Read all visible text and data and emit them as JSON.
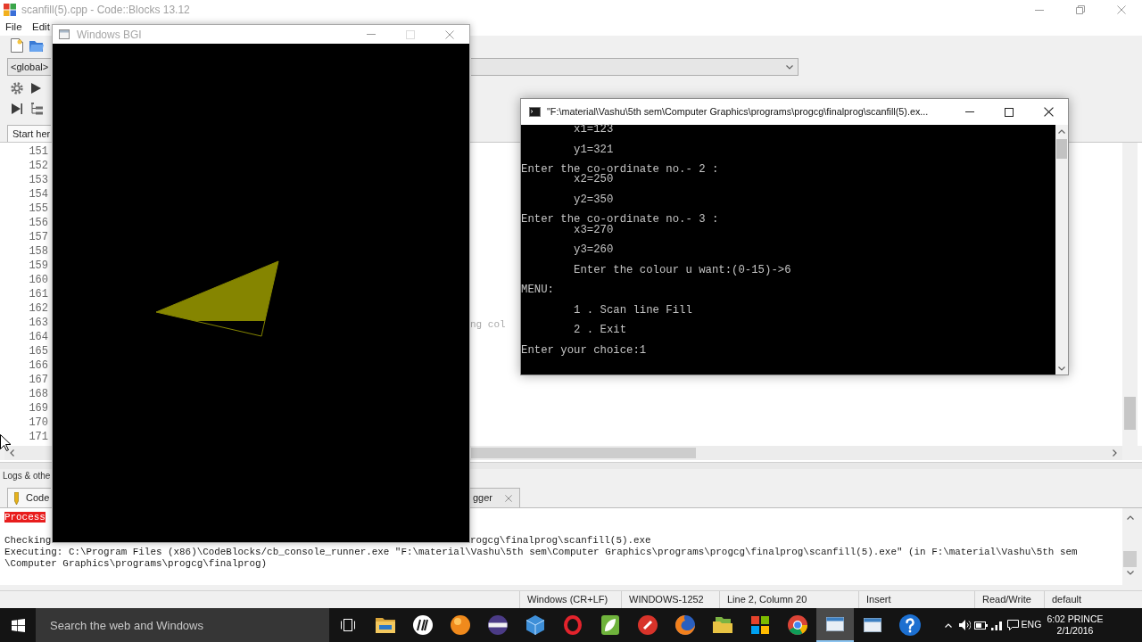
{
  "main_window": {
    "title": "scanfill(5).cpp - Code::Blocks 13.12"
  },
  "menu": [
    "File",
    "Edit"
  ],
  "toolbar": {
    "dropdown_value": "<global>"
  },
  "editor": {
    "tab": "Start her",
    "lines": [
      {
        "number": "151"
      },
      {
        "number": "152"
      },
      {
        "number": "153"
      },
      {
        "number": "154"
      },
      {
        "number": "155"
      },
      {
        "number": "156"
      },
      {
        "number": "157"
      },
      {
        "number": "158"
      },
      {
        "number": "159"
      },
      {
        "number": "160"
      },
      {
        "number": "161"
      },
      {
        "number": "162"
      },
      {
        "number": "163",
        "code": "ng col"
      },
      {
        "number": "164"
      },
      {
        "number": "165"
      },
      {
        "number": "166"
      },
      {
        "number": "167"
      },
      {
        "number": "168"
      },
      {
        "number": "169"
      },
      {
        "number": "170"
      },
      {
        "number": "171"
      }
    ]
  },
  "logs": {
    "title": "Logs & othe",
    "tabs": [
      {
        "label": "Code",
        "kind": "icon"
      },
      {
        "label": "gger",
        "kind": "closable"
      }
    ],
    "lines": [
      {
        "kind": "highlight",
        "parts": [
          "Process"
        ]
      },
      {
        "kind": "plain",
        "parts": [
          "Checking",
          "rogcg\\finalprog\\scanfill(5).exe"
        ]
      },
      {
        "kind": "plain",
        "parts": [
          "Executing: C:\\Program Files (x86)\\CodeBlocks/cb_console_runner.exe \"F:\\material\\Vashu\\5th sem\\Computer Graphics\\programs\\progcg\\finalprog\\scanfill(5).exe\" (in F:\\material\\Vashu\\5th sem"
        ]
      },
      {
        "kind": "plain",
        "parts": [
          "\\Computer Graphics\\programs\\progcg\\finalprog)"
        ]
      }
    ]
  },
  "status_bar": [
    "Windows (CR+LF)",
    "WINDOWS-1252",
    "Line 2, Column 20",
    "Insert",
    "Read/Write",
    "default"
  ],
  "bgi_window": {
    "title": "Windows BGI",
    "maximize_disabled": true
  },
  "console_window": {
    "title": "\"F:\\material\\Vashu\\5th sem\\Computer Graphics\\programs\\progcg\\finalprog\\scanfill(5).ex...",
    "sections": [
      {
        "blocks": [
          {
            "lines": [
              {
                "text": "x1=123",
                "indented": true
              }
            ]
          },
          {
            "lines": [
              {
                "text": "y1=321",
                "indented": true
              }
            ]
          },
          {
            "lines": [
              {
                "text": "Enter the co-ordinate no.- 2 :",
                "indented": false
              },
              {
                "text": "x2=250",
                "indented": true
              }
            ]
          },
          {
            "lines": [
              {
                "text": "y2=350",
                "indented": true
              }
            ]
          },
          {
            "lines": [
              {
                "text": "Enter the co-ordinate no.- 3 :",
                "indented": false
              },
              {
                "text": "x3=270",
                "indented": true
              }
            ]
          },
          {
            "lines": [
              {
                "text": "y3=260",
                "indented": true
              }
            ]
          },
          {
            "lines": [
              {
                "text": "Enter the colour u want:(0-15)->6",
                "indented": true
              }
            ]
          }
        ]
      },
      {
        "blocks": [
          {
            "lines": [
              {
                "text": "MENU:",
                "indented": false
              }
            ]
          },
          {
            "lines": [
              {
                "text": "1 . Scan line Fill",
                "indented": true
              }
            ]
          },
          {
            "lines": [
              {
                "text": "2 . Exit",
                "indented": true
              }
            ]
          },
          {
            "lines": [
              {
                "text": "Enter your choice:1",
                "indented": false
              }
            ]
          }
        ]
      }
    ]
  },
  "taskbar": {
    "search": {
      "placeholder": "Search the web and Windows"
    },
    "apps": [
      {
        "kind": "taskview",
        "selected": false
      },
      {
        "kind": "folder",
        "selected": false
      },
      {
        "kind": "roundlogo",
        "selected": false
      },
      {
        "kind": "sphere",
        "selected": false
      },
      {
        "kind": "ringsphere",
        "selected": false
      },
      {
        "kind": "cube",
        "selected": false
      },
      {
        "kind": "ring",
        "selected": false
      },
      {
        "kind": "leaf",
        "selected": false
      },
      {
        "kind": "badge",
        "selected": false
      },
      {
        "kind": "globe",
        "selected": false
      },
      {
        "kind": "folders",
        "selected": false
      },
      {
        "kind": "grid",
        "selected": false
      },
      {
        "kind": "swirl",
        "selected": false
      },
      {
        "kind": "window",
        "selected": true
      },
      {
        "kind": "window",
        "selected": false
      },
      {
        "kind": "help",
        "selected": false
      }
    ],
    "tray": {
      "language": "ENG",
      "time": "6:02 PRINCE",
      "date": "2/1/2016"
    }
  }
}
